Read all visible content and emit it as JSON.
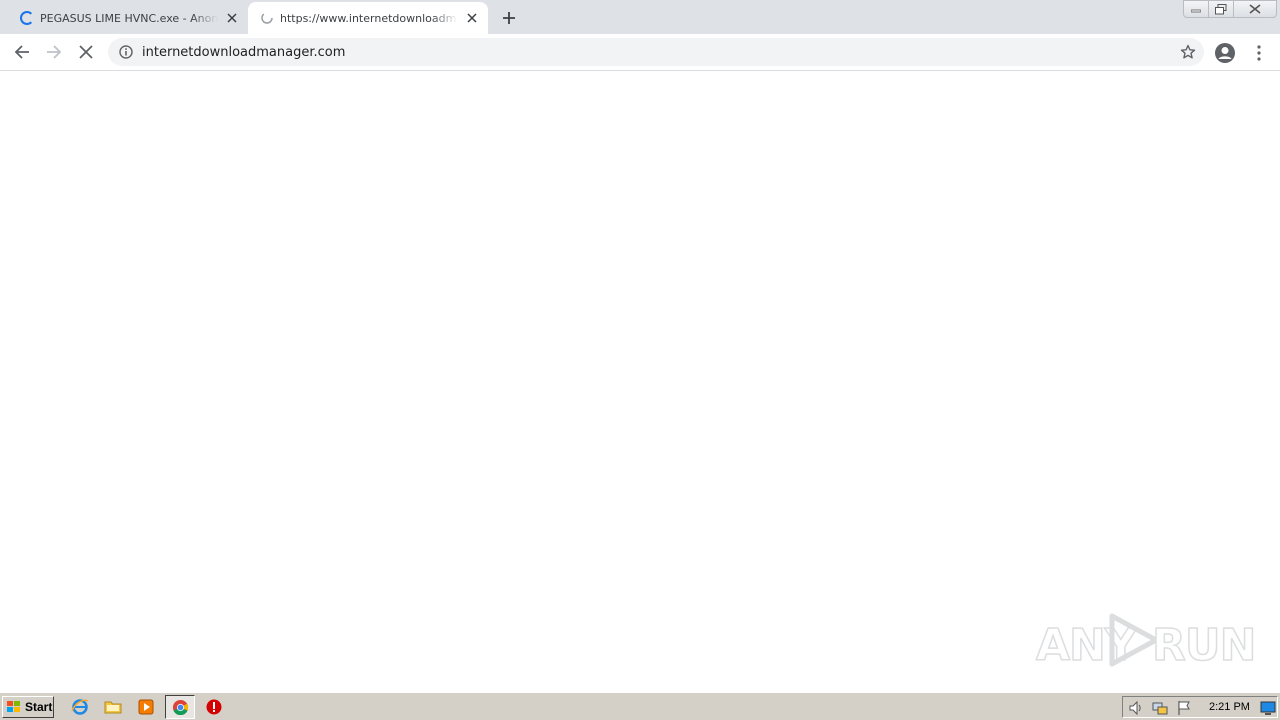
{
  "browser": {
    "tabs": [
      {
        "title": "PEGASUS LIME HVNC.exe - AnonFile",
        "state": "loading",
        "active": false
      },
      {
        "title": "https://www.internetdownloadmanager.c",
        "state": "loading",
        "active": true
      }
    ],
    "new_tab_icon": "plus-icon",
    "address": "internetdownloadmanager.com",
    "colors": {
      "tabstrip": "#dee1e6",
      "omnibox": "#f1f3f4",
      "spinner": "#1a73e8"
    }
  },
  "watermark": {
    "text_left": "ANY",
    "text_right": "RUN"
  },
  "taskbar": {
    "start_label": "Start",
    "clock": "2:21 PM",
    "quick_launch": [
      "internet-explorer-icon",
      "folder-icon",
      "media-player-icon",
      "chrome-icon",
      "stop-icon"
    ],
    "tray": [
      "speaker-icon",
      "network-icon",
      "flag-icon"
    ]
  }
}
